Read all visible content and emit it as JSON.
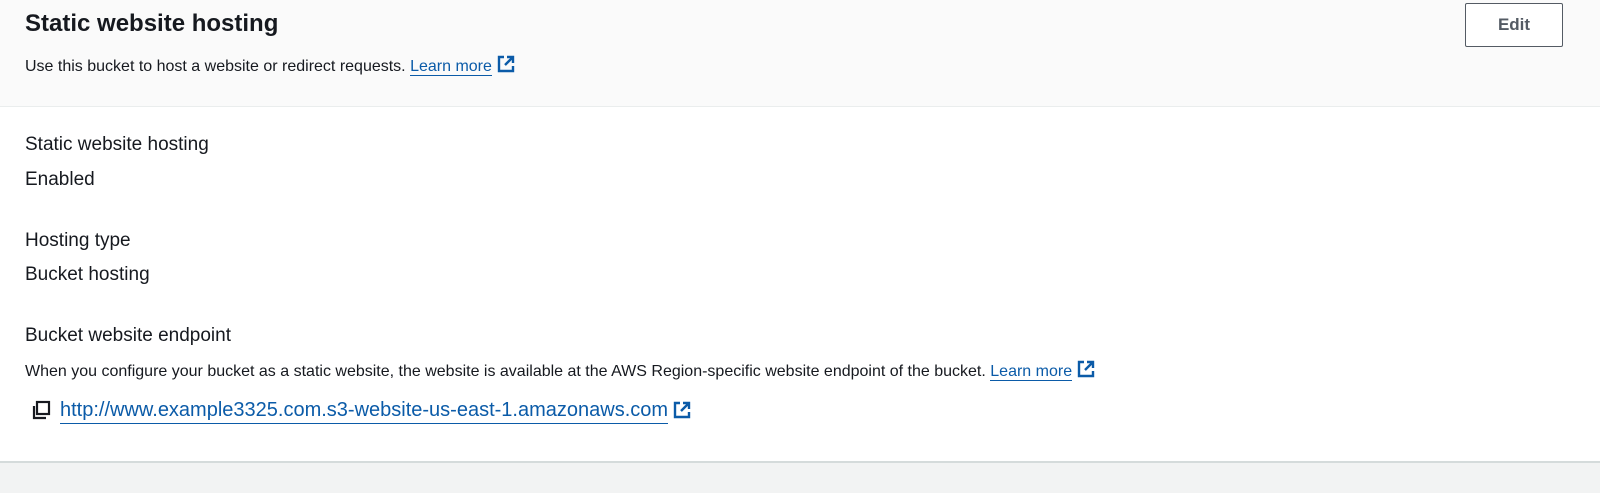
{
  "header": {
    "title": "Static website hosting",
    "description": "Use this bucket to host a website or redirect requests.",
    "learn_more": "Learn more",
    "edit_label": "Edit"
  },
  "fields": {
    "hosting": {
      "label": "Static website hosting",
      "value": "Enabled"
    },
    "type": {
      "label": "Hosting type",
      "value": "Bucket hosting"
    },
    "endpoint": {
      "label": "Bucket website endpoint",
      "description": "When you configure your bucket as a static website, the website is available at the AWS Region-specific website endpoint of the bucket.",
      "learn_more": "Learn more",
      "url": "http://www.example3325.com.s3-website-us-east-1.amazonaws.com"
    }
  },
  "icons": {
    "external": "external-link-icon",
    "copy": "copy-icon"
  },
  "colors": {
    "link": "#0b5ba8",
    "text": "#16191f",
    "header_bg": "#fafafa"
  }
}
